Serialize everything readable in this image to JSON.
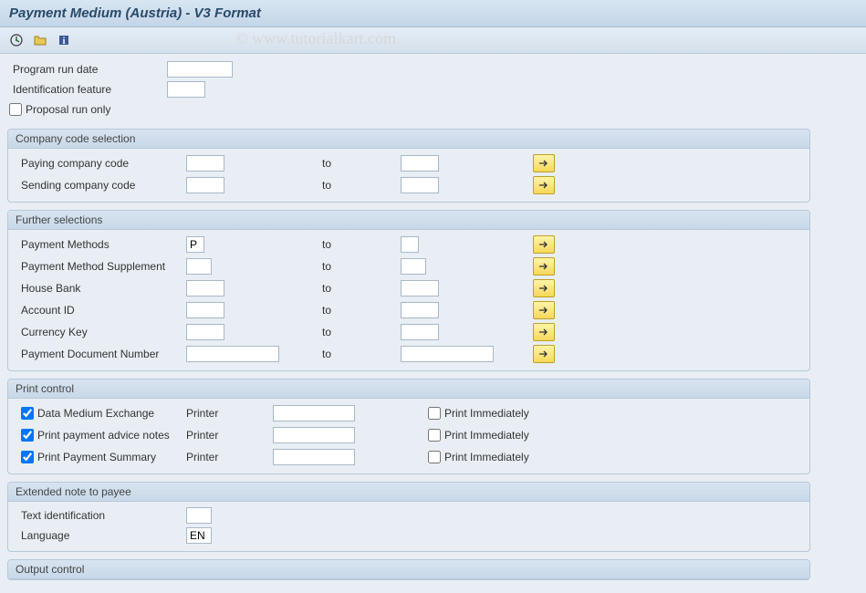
{
  "title": "Payment Medium (Austria) - V3 Format",
  "watermark": "© www.tutorialkart.com",
  "toolbar": {
    "execute": "execute",
    "getvar": "get-variant",
    "info": "info"
  },
  "top": {
    "program_run_date_label": "Program run date",
    "program_run_date_value": "",
    "identification_label": "Identification feature",
    "identification_value": "",
    "proposal_label": "Proposal run only",
    "proposal_checked": false
  },
  "company": {
    "header": "Company code selection",
    "rows": [
      {
        "label": "Paying company code",
        "from": "",
        "to_label": "to",
        "to": ""
      },
      {
        "label": "Sending company code",
        "from": "",
        "to_label": "to",
        "to": ""
      }
    ]
  },
  "further": {
    "header": "Further selections",
    "rows": [
      {
        "label": "Payment Methods",
        "from": "P",
        "to_label": "to",
        "to": "",
        "size": "xs"
      },
      {
        "label": "Payment Method Supplement",
        "from": "",
        "to_label": "to",
        "to": "",
        "size": "xs"
      },
      {
        "label": "House Bank",
        "from": "",
        "to_label": "to",
        "to": "",
        "size": "sm"
      },
      {
        "label": "Account ID",
        "from": "",
        "to_label": "to",
        "to": "",
        "size": "sm"
      },
      {
        "label": "Currency Key",
        "from": "",
        "to_label": "to",
        "to": "",
        "size": "sm"
      },
      {
        "label": "Payment Document Number",
        "from": "",
        "to_label": "to",
        "to": "",
        "size": "lg"
      }
    ]
  },
  "print": {
    "header": "Print control",
    "rows": [
      {
        "check_label": "Data Medium Exchange",
        "checked": true,
        "printer_label": "Printer",
        "printer_value": "",
        "immed_label": "Print Immediately",
        "immed_checked": false
      },
      {
        "check_label": "Print payment advice notes",
        "checked": true,
        "printer_label": "Printer",
        "printer_value": "",
        "immed_label": "Print Immediately",
        "immed_checked": false
      },
      {
        "check_label": "Print Payment Summary",
        "checked": true,
        "printer_label": "Printer",
        "printer_value": "",
        "immed_label": "Print Immediately",
        "immed_checked": false
      }
    ]
  },
  "extended": {
    "header": "Extended note to payee",
    "text_id_label": "Text identification",
    "text_id_value": "",
    "language_label": "Language",
    "language_value": "EN"
  },
  "output": {
    "header": "Output control"
  }
}
